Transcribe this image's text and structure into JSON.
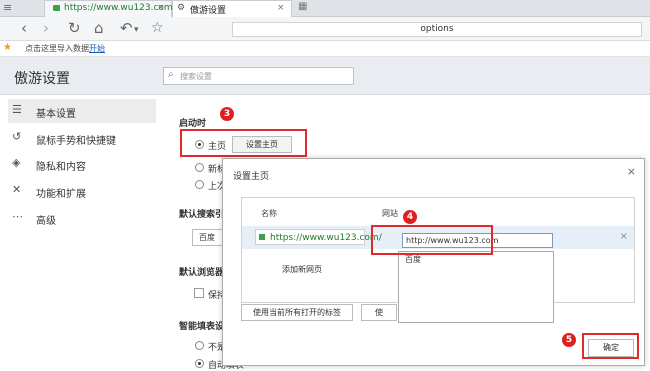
{
  "browser": {
    "tab1_url": "https://www.wu123.com/",
    "tab1_close": "×",
    "tab2_title": "傲游设置",
    "tab2_close": "×",
    "url_bar": "options",
    "bookmark_text": "点击这里导入数据",
    "bookmark_link": "开始"
  },
  "settings": {
    "title": "傲游设置",
    "search_placeholder": "搜索设置"
  },
  "sidebar": {
    "items": [
      {
        "label": "基本设置",
        "icon": "sliders-icon"
      },
      {
        "label": "鼠标手势和快捷键",
        "icon": "gesture-icon"
      },
      {
        "label": "隐私和内容",
        "icon": "shield-icon"
      },
      {
        "label": "功能和扩展",
        "icon": "wrench-icon"
      },
      {
        "label": "高级",
        "icon": "more-icon"
      }
    ]
  },
  "main": {
    "startup_title": "启动时",
    "startup_home": "主页",
    "set_home_button": "设置主页",
    "startup_newtab": "新标",
    "startup_last": "上次",
    "search_title": "默认搜索引",
    "search_value": "百度",
    "browser_title": "默认浏览器",
    "browser_check": "保持",
    "autofill_title": "智能填表设",
    "autofill_opt1": "不是",
    "autofill_opt2": "自动填表"
  },
  "dialog": {
    "title": "设置主页",
    "close": "×",
    "col_name": "名称",
    "col_site": "网站",
    "row_url_image": "https://www.wu123.com/",
    "row_url_input": "http://www.wu123.com",
    "row_delete": "×",
    "dropdown_item": "百度",
    "add_new": "添加新网页",
    "use_current_button": "使用当前所有打开的标签",
    "second_button": "使",
    "ok_button": "确定"
  },
  "markers": [
    "3",
    "4",
    "5"
  ],
  "colors": {
    "highlight_red": "#e12b2b",
    "marker_red": "#e02020",
    "accent_green": "#3aa34a"
  }
}
